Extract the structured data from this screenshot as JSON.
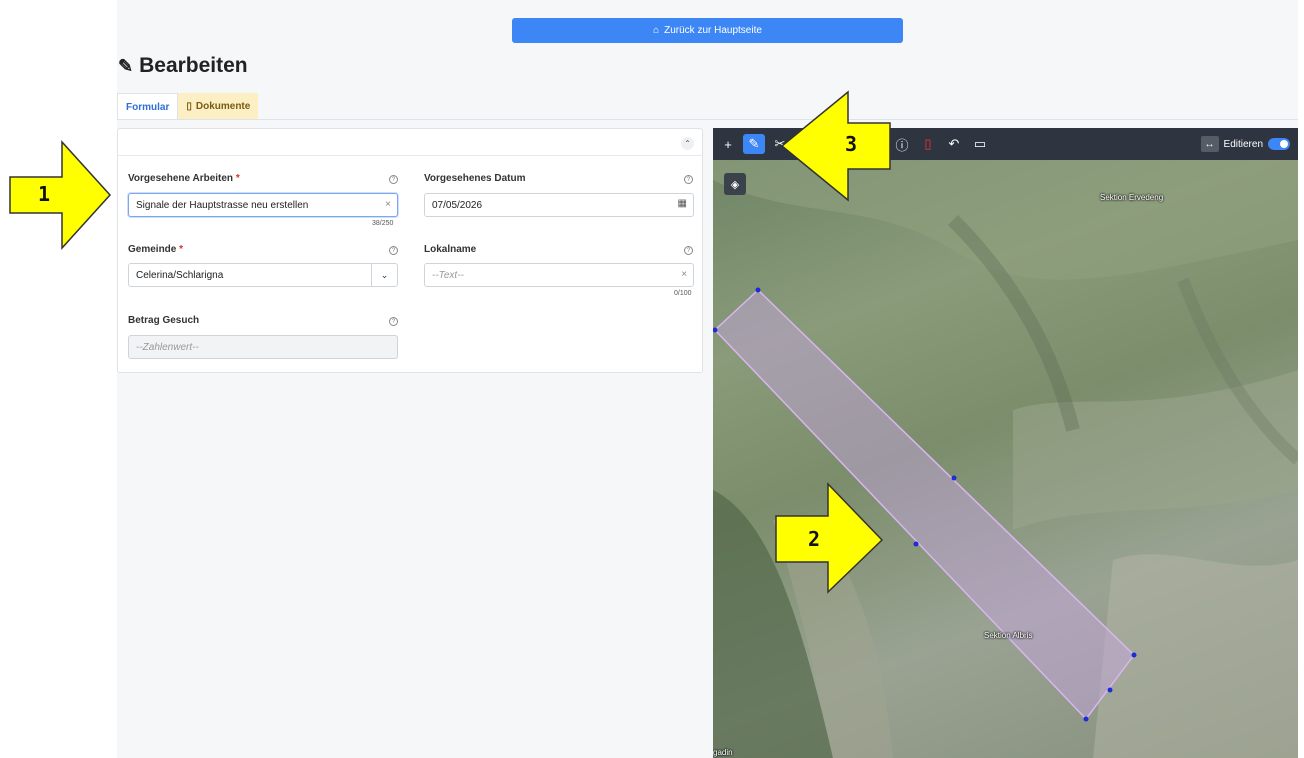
{
  "header": {
    "home_button_label": "Zurück zur Hauptseite"
  },
  "page": {
    "title": "Bearbeiten"
  },
  "tabs": [
    {
      "label": "Formular",
      "active": true
    },
    {
      "label": "Dokumente",
      "active": false
    }
  ],
  "form": {
    "arbeiten": {
      "label": "Vorgesehene Arbeiten",
      "required_mark": "*",
      "value": "Signale der Hauptstrasse neu erstellen",
      "counter": "38/250"
    },
    "datum": {
      "label": "Vorgesehenes Datum",
      "value": "07/05/2026"
    },
    "gemeinde": {
      "label": "Gemeinde",
      "required_mark": "*",
      "value": "Celerina/Schlarigna"
    },
    "lokalname": {
      "label": "Lokalname",
      "placeholder": "--Text--",
      "counter": "0/100"
    },
    "betrag": {
      "label": "Betrag Gesuch",
      "placeholder": "--Zahlenwert--"
    }
  },
  "map": {
    "edit_label": "Editieren",
    "labels": [
      "Sektion Ervedeng",
      "Sektion Albris",
      "gadin"
    ]
  },
  "callouts": [
    "1",
    "2",
    "3"
  ],
  "colors": {
    "accent": "#3d86f6",
    "callout_fill": "#ffff00",
    "polygon": "#c9a6e6"
  }
}
